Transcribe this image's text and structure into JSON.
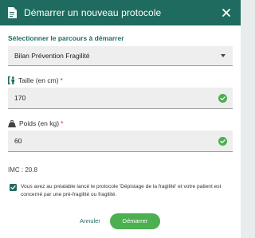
{
  "header": {
    "title": "Démarrer un nouveau protocole",
    "bg_color": "#1f6b5f"
  },
  "parcours": {
    "label": "Sélectionner le parcours à démarrer",
    "selected": "Bilan Prévention Fragilité"
  },
  "taille": {
    "label": "Taille (en cm)",
    "required_mark": "*",
    "value": "170"
  },
  "poids": {
    "label": "Poids (en kg)",
    "required_mark": "*",
    "value": "60"
  },
  "imc": {
    "text": "IMC : 20.8"
  },
  "consent": {
    "checked": true,
    "text": "Vous avez au préalable lancé le protocole 'Dépistage de la fragilité' et votre patient est concerné par une pré-fragilité ou fragilité."
  },
  "actions": {
    "cancel_label": "Annuler",
    "start_label": "Démarrer"
  },
  "colors": {
    "accent": "#1f6b5f",
    "success": "#4caf50",
    "required": "#d32f2f"
  },
  "icons": {
    "header": "document-icon",
    "close": "close-icon",
    "height": "height-icon",
    "weight": "weight-icon",
    "valid": "check-circle-icon"
  }
}
